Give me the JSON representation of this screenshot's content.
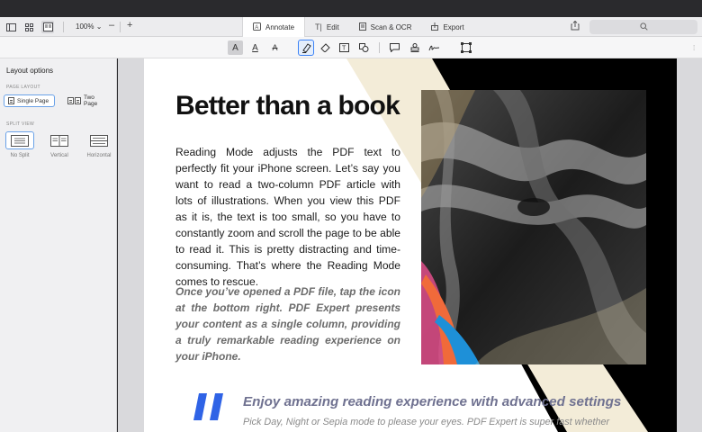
{
  "toolbar": {
    "zoom": "100%",
    "zoom_minus": "–",
    "zoom_plus": "+",
    "tabs": [
      {
        "label": "Annotate",
        "icon": "annotate-icon"
      },
      {
        "label": "Edit",
        "icon": "text-cursor-icon"
      },
      {
        "label": "Scan & OCR",
        "icon": "scan-icon"
      },
      {
        "label": "Export",
        "icon": "export-icon"
      }
    ],
    "active_tab": "Annotate"
  },
  "annotate_tools": [
    "highlight-text",
    "underline-text",
    "strikethrough-text",
    "highlighter",
    "eraser",
    "text-box",
    "shapes",
    "comment",
    "stamp",
    "signature",
    "selection"
  ],
  "sidebar": {
    "title": "Layout options",
    "page_layout_header": "PAGE LAYOUT",
    "page_layout": [
      {
        "label": "Single Page",
        "selected": true
      },
      {
        "label": "Two Page",
        "selected": false
      }
    ],
    "split_view_header": "SPLIT VIEW",
    "split_view": [
      {
        "label": "No Split",
        "selected": true
      },
      {
        "label": "Vertical",
        "selected": false
      },
      {
        "label": "Horizontal",
        "selected": false
      }
    ]
  },
  "document": {
    "heading": "Better than a book",
    "body": "Reading Mode adjusts the PDF text to perfectly fit your iPhone screen. Let’s say you want to read a two-column PDF article with lots of illustrations. When you view this PDF as it is, the text is too small, so you have to constantly zoom and scroll the page to be able to read it. This is pretty distracting and time-consuming. That’s where the Reading Mode comes to rescue.",
    "italic": "Once you’ve opened a PDF file, tap the icon at the bottom right. PDF Expert presents your content as a single column, providing a truly remarkable reading experience on your iPhone.",
    "quote_title": "Enjoy amazing reading experience with advanced settings",
    "quote_body": "Pick Day, Night or Sepia mode to please your eyes. PDF Expert is super fast whether"
  },
  "colors": {
    "accent": "#3b82f6",
    "quote_blue": "#2f63e6",
    "beige": "#f3ecd8"
  }
}
